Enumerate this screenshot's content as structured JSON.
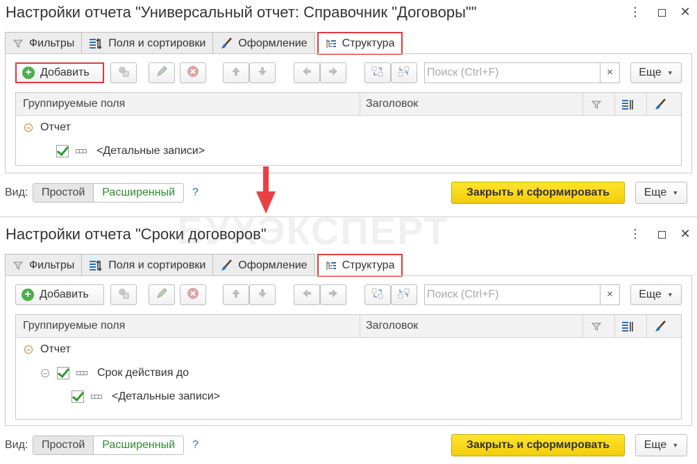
{
  "windows": [
    {
      "title": "Настройки отчета \"Универсальный отчет: Справочник \"Договоры\"\"",
      "tabs": [
        "Фильтры",
        "Поля и сортировки",
        "Оформление",
        "Структура"
      ],
      "active_tab": "Структура",
      "toolbar": {
        "add_label": "Добавить",
        "search_placeholder": "Поиск (Ctrl+F)",
        "search_clear": "×",
        "more_label": "Еще"
      },
      "grid": {
        "col_fields": "Группируемые поля",
        "col_title": "Заголовок",
        "rows": [
          "Отчет",
          "<Детальные записи>"
        ]
      },
      "bottom": {
        "view_label": "Вид:",
        "view_simple": "Простой",
        "view_extended": "Расширенный",
        "help": "?",
        "primary": "Закрыть и сформировать",
        "more": "Еще"
      }
    },
    {
      "title": "Настройки отчета \"Сроки договоров\"",
      "tabs": [
        "Фильтры",
        "Поля и сортировки",
        "Оформление",
        "Структура"
      ],
      "active_tab": "Структура",
      "toolbar": {
        "add_label": "Добавить",
        "search_placeholder": "Поиск (Ctrl+F)",
        "search_clear": "×",
        "more_label": "Еще"
      },
      "grid": {
        "col_fields": "Группируемые поля",
        "col_title": "Заголовок",
        "rows": [
          "Отчет",
          "Срок действия до",
          "<Детальные записи>"
        ]
      },
      "bottom": {
        "view_label": "Вид:",
        "view_simple": "Простой",
        "view_extended": "Расширенный",
        "help": "?",
        "primary": "Закрыть и сформировать",
        "more": "Еще"
      }
    }
  ],
  "watermark": "БУХЭКСПЕРТ",
  "colors": {
    "highlight": "#e0393e",
    "primary_button": "#f5d20f",
    "check": "#2a9a2a",
    "arrow": "#e94045"
  },
  "icons": [
    "filter-icon",
    "fields-sort-icon",
    "brush-icon",
    "structure-icon",
    "plus-circle-icon",
    "copy-icon",
    "pencil-icon",
    "delete-icon",
    "arrow-up-icon",
    "arrow-down-icon",
    "arrow-left-icon",
    "arrow-right-icon",
    "group-icon",
    "ungroup-icon",
    "field-icon",
    "checkbox-icon"
  ]
}
